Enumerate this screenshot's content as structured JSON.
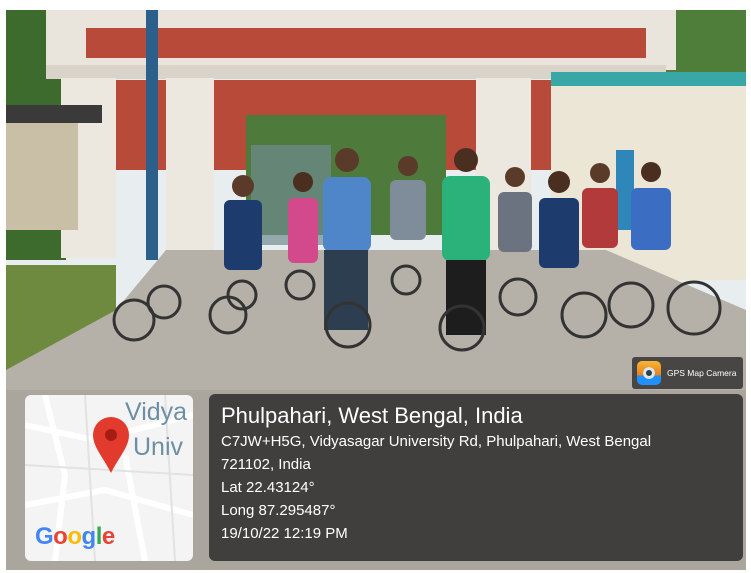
{
  "badge": {
    "label": "GPS Map Camera"
  },
  "map": {
    "label_line1": "Vidya",
    "label_line2": "Univ",
    "logo_letters": [
      "G",
      "o",
      "o",
      "g",
      "l",
      "e"
    ],
    "logo_colors": [
      "#4285F4",
      "#EA4335",
      "#FBBC05",
      "#4285F4",
      "#34A853",
      "#EA4335"
    ]
  },
  "info": {
    "place": "Phulpahari, West Bengal, India",
    "address_line1": "C7JW+H5G, Vidyasagar University Rd, Phulpahari, West Bengal",
    "address_line2": "721102, India",
    "lat": "Lat 22.43124°",
    "long": "Long 87.295487°",
    "datetime": "19/10/22 12:19 PM"
  }
}
